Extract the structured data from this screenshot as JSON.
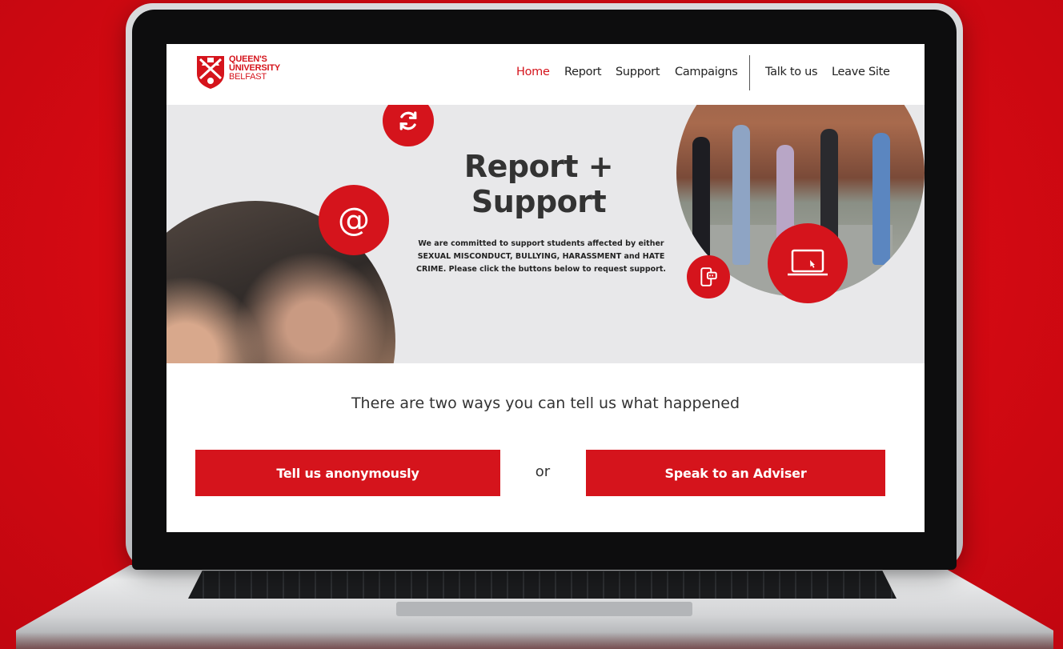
{
  "logo": {
    "line1": "QUEEN'S",
    "line2": "UNIVERSITY",
    "line3": "BELFAST"
  },
  "nav": {
    "items": [
      {
        "label": "Home",
        "active": true
      },
      {
        "label": "Report",
        "active": false
      },
      {
        "label": "Support",
        "active": false
      },
      {
        "label": "Campaigns",
        "active": false
      }
    ],
    "secondary": [
      {
        "label": "Talk to us"
      },
      {
        "label": "Leave Site"
      }
    ]
  },
  "hero": {
    "title_line1": "Report +",
    "title_line2": "Support",
    "description": "We are committed to support students affected by either SEXUAL MISCONDUCT, BULLYING, HARASSMENT and HATE CRIME. Please click the buttons below to request support.",
    "icons": [
      "refresh-icon",
      "at-sign-icon",
      "mobile-chat-icon",
      "laptop-icon"
    ]
  },
  "main": {
    "heading": "There are two ways you can tell us what happened",
    "anonymous_button": "Tell us anonymously",
    "or_label": "or",
    "adviser_button": "Speak to an Adviser"
  },
  "colors": {
    "brand_red": "#d5141c",
    "hero_bg": "#e8e8ea",
    "text_dark": "#333333"
  }
}
